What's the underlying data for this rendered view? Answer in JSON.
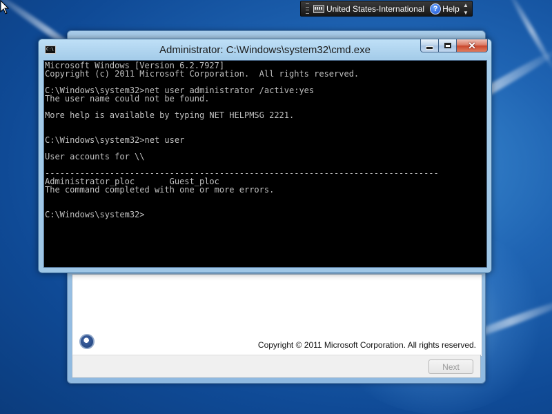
{
  "language_bar": {
    "language": "United States-International",
    "help": "Help",
    "help_icon": "?"
  },
  "cmd_window": {
    "title": "Administrator: C:\\Windows\\system32\\cmd.exe",
    "icon_text": "C:\\",
    "lines": [
      "Microsoft Windows [Version 6.2.7927]",
      "Copyright (c) 2011 Microsoft Corporation.  All rights reserved.",
      "",
      "C:\\Windows\\system32>net user administrator /active:yes",
      "The user name could not be found.",
      "",
      "More help is available by typing NET HELPMSG 2221.",
      "",
      "",
      "C:\\Windows\\system32>net user",
      "",
      "User accounts for \\\\",
      "",
      "-------------------------------------------------------------------------------",
      "Administrator_ploc       Guest_ploc",
      "The command completed with one or more errors.",
      "",
      "",
      "C:\\Windows\\system32>"
    ]
  },
  "setup_window": {
    "copyright": "Copyright © 2011 Microsoft Corporation.  All rights reserved.",
    "next_label": "Next"
  },
  "icons": {
    "cursor": "arrow-cursor-icon",
    "keyboard": "keyboard-icon",
    "help": "help-icon",
    "setup_logo": "windows-setup-icon"
  }
}
